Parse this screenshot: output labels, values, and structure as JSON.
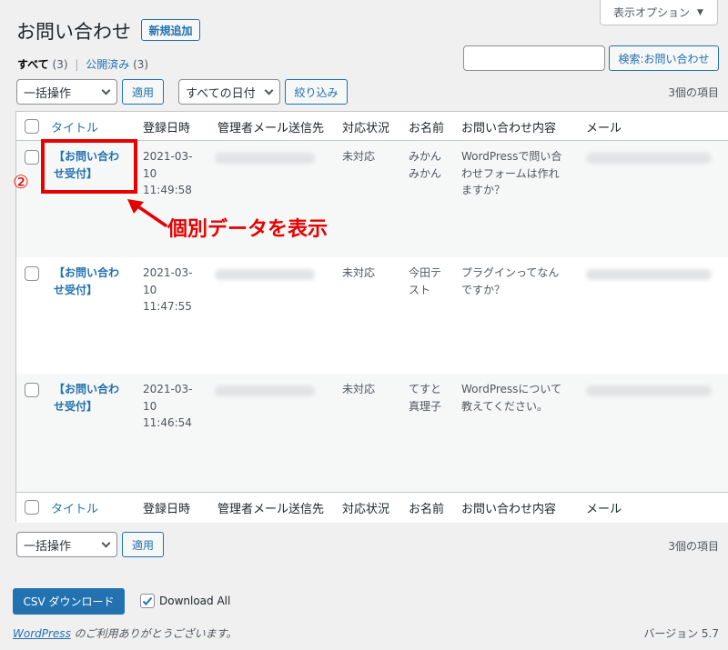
{
  "screen_options": "表示オプション",
  "page_title": "お問い合わせ",
  "add_new": "新規追加",
  "filters": {
    "all_label": "すべて",
    "all_count": "(3)",
    "separator": "|",
    "published_label": "公開済み",
    "published_count": "(3)"
  },
  "search": {
    "value": "",
    "button": "検索:お問い合わせ"
  },
  "bulk": {
    "selected": "一括操作",
    "apply": "適用"
  },
  "date_filter": {
    "selected": "すべての日付",
    "filter_button": "絞り込み"
  },
  "item_count": "3個の項目",
  "columns": [
    "タイトル",
    "登録日時",
    "管理者メール送信先",
    "対応状況",
    "お名前",
    "お問い合わせ内容",
    "メール"
  ],
  "rows": [
    {
      "title_line1": "【お問い合わ",
      "title_line2": "せ受付】",
      "date": "2021-03-",
      "day": "10",
      "time": "11:49:58",
      "status": "未対応",
      "name_line1": "みかん",
      "name_line2": "みかん",
      "content_line1": "WordPressで問い合",
      "content_line2": "わせフォームは作れ",
      "content_line3": "ますか？"
    },
    {
      "title_line1": "【お問い合わ",
      "title_line2": "せ受付】",
      "date": "2021-03-",
      "day": "10",
      "time": "11:47:55",
      "status": "未対応",
      "name_line1": "今田テ",
      "name_line2": "スト",
      "content_line1": "プラグインってなん",
      "content_line2": "ですか？",
      "content_line3": ""
    },
    {
      "title_line1": "【お問い合わ",
      "title_line2": "せ受付】",
      "date": "2021-03-",
      "day": "10",
      "time": "11:46:54",
      "status": "未対応",
      "name_line1": "てすと",
      "name_line2": "真理子",
      "content_line1": "WordPressについて",
      "content_line2": "教えてください。",
      "content_line3": ""
    }
  ],
  "annotation": {
    "marker": "②",
    "text": "個別データを表示",
    "color": "#e60000"
  },
  "csv_download": "CSV ダウンロード",
  "download_all": "Download All",
  "footer": {
    "wordpress_link": "WordPress",
    "thanks": " のご利用ありがとうございます。",
    "version": "バージョン 5.7"
  },
  "colors": {
    "accent": "#2271b1",
    "annotation": "#e60000"
  }
}
